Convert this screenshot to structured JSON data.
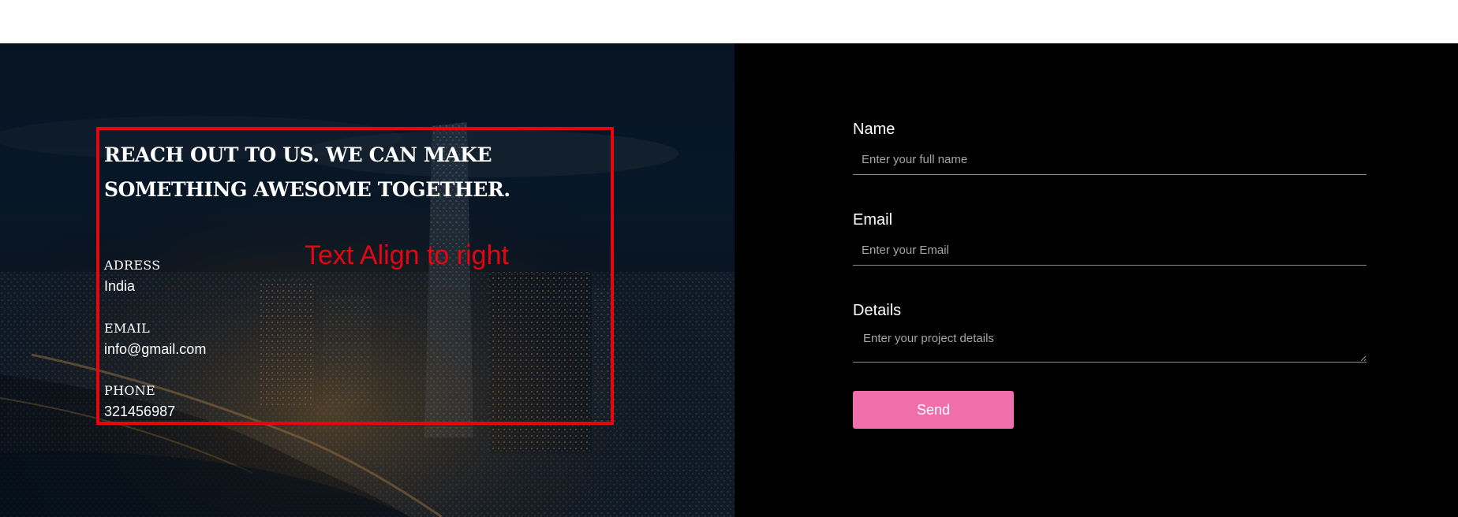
{
  "contact": {
    "heading": "Reach out to us. We can make something awesome together.",
    "annotation": "Text Align to right",
    "address_label": "ADRESS",
    "address_value": "India",
    "email_label": "EMAIL",
    "email_value": "info@gmail.com",
    "phone_label": "PHONE",
    "phone_value": "321456987"
  },
  "form": {
    "name_label": "Name",
    "name_placeholder": "Enter your full name",
    "email_label": "Email",
    "email_placeholder": "Enter your Email",
    "details_label": "Details",
    "details_placeholder": "Enter your project details",
    "send_label": "Send"
  },
  "colors": {
    "annotation_red": "#e8050c",
    "send_button": "#f06ea9",
    "form_background": "#000000"
  }
}
